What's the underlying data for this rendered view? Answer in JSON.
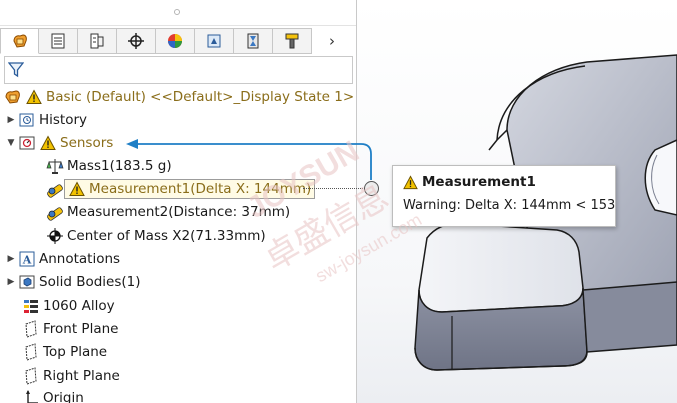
{
  "colors": {
    "accent": "#1f7fc6",
    "warning": "#f2c200",
    "warning_text": "#8a6d1a",
    "part_face": "#b8bcc8",
    "part_shadow": "#8b90a0",
    "watermark": "#e8c4c4"
  },
  "tabs": [
    {
      "icon": "feature-manager-icon",
      "active": true
    },
    {
      "icon": "property-manager-icon"
    },
    {
      "icon": "configuration-manager-icon"
    },
    {
      "icon": "dimxpert-icon"
    },
    {
      "icon": "display-manager-icon"
    },
    {
      "icon": "cam-feature-icon"
    },
    {
      "icon": "cam-operation-icon"
    },
    {
      "icon": "cam-tool-icon"
    }
  ],
  "tabs_more": "›",
  "filter_icon": "filter-icon",
  "tree": {
    "root_label": "Basic (Default) <<Default>_Display State 1>",
    "history": "History",
    "sensors": "Sensors",
    "mass1": "Mass1(183.5 g)",
    "measurement1": "Measurement1(Delta X: 144mm)",
    "measurement2": "Measurement2(Distance: 37mm)",
    "center_of_mass": "Center of Mass X2(71.33mm)",
    "annotations": "Annotations",
    "solid_bodies": "Solid Bodies(1)",
    "material": "1060 Alloy",
    "front_plane": "Front Plane",
    "top_plane": "Top Plane",
    "right_plane": "Right Plane",
    "origin": "Origin"
  },
  "tooltip": {
    "title": "Measurement1",
    "message": "Warning: Delta X: 144mm < 153"
  },
  "watermark": {
    "brand": "JOYSUN",
    "cn": "卓盛信息",
    "url": "sw-joysun.com"
  }
}
